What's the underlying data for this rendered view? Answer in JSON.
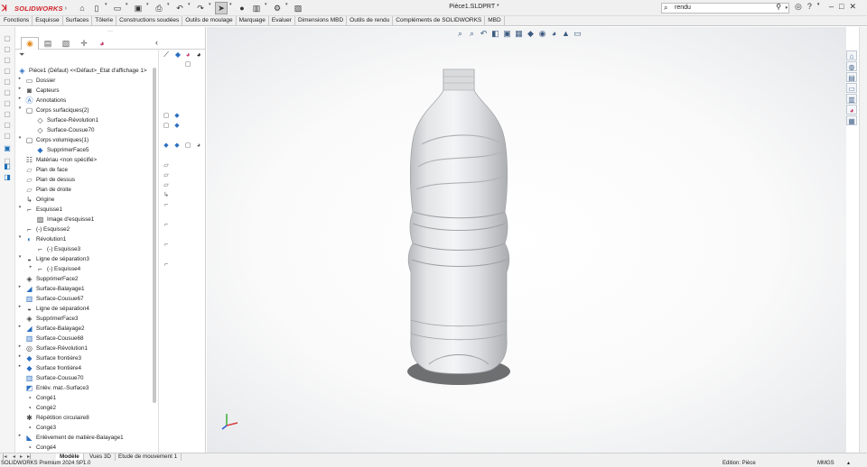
{
  "app": {
    "brand": "SOLIDWORKS",
    "document_title": "Pièce1.SLDPRT *"
  },
  "search": {
    "value": "rendu"
  },
  "command_tabs": [
    "Fonctions",
    "Esquisse",
    "Surfaces",
    "Tôlerie",
    "Constructions soudées",
    "Outils de moulage",
    "Marquage",
    "Evaluer",
    "Dimensions MBD",
    "Outils de rendu",
    "Compléments de SOLIDWORKS",
    "MBD"
  ],
  "feature_tree": {
    "root": "Pièce1 (Défaut) <<Défaut>_Etat d'affichage 1>",
    "items": [
      {
        "label": "Dossier",
        "icon": "folder-icon"
      },
      {
        "label": "Capteurs",
        "icon": "sensor-icon"
      },
      {
        "label": "Annotations",
        "icon": "annotation-icon"
      },
      {
        "label": "Corps surfaciques(2)",
        "icon": "surface-bodies-icon"
      },
      {
        "label": "Surface-Révolution1",
        "icon": "surface-icon"
      },
      {
        "label": "Surface-Cousue70",
        "icon": "surface-icon"
      },
      {
        "label": "Corps volumiques(1)",
        "icon": "solid-bodies-icon"
      },
      {
        "label": "SupprimerFace5",
        "icon": "solid-body-icon"
      },
      {
        "label": "Matériau <non spécifié>",
        "icon": "material-icon"
      },
      {
        "label": "Plan de face",
        "icon": "plane-icon"
      },
      {
        "label": "Plan de dessus",
        "icon": "plane-icon"
      },
      {
        "label": "Plan de droite",
        "icon": "plane-icon"
      },
      {
        "label": "Origine",
        "icon": "origin-icon"
      },
      {
        "label": "Esquisse1",
        "icon": "sketch-icon"
      },
      {
        "label": "Image d'esquisse1",
        "icon": "sketch-picture-icon"
      },
      {
        "label": "(-) Esquisse2",
        "icon": "sketch-icon"
      },
      {
        "label": "Révolution1",
        "icon": "revolve-icon"
      },
      {
        "label": "(-) Esquisse3",
        "icon": "sketch-icon"
      },
      {
        "label": "Ligne de séparation3",
        "icon": "split-line-icon"
      },
      {
        "label": "(-) Esquisse4",
        "icon": "sketch-icon"
      },
      {
        "label": "SupprimerFace2",
        "icon": "delete-face-icon"
      },
      {
        "label": "Surface-Balayage1",
        "icon": "sweep-surface-icon"
      },
      {
        "label": "Surface-Cousue67",
        "icon": "knit-surface-icon"
      },
      {
        "label": "Ligne de séparation4",
        "icon": "split-line-icon"
      },
      {
        "label": "SupprimerFace3",
        "icon": "delete-face-icon"
      },
      {
        "label": "Surface-Balayage2",
        "icon": "sweep-surface-icon"
      },
      {
        "label": "Surface-Cousue68",
        "icon": "knit-surface-icon"
      },
      {
        "label": "Surface-Révolution1",
        "icon": "revolve-surface-icon"
      },
      {
        "label": "Surface frontière3",
        "icon": "boundary-surface-icon"
      },
      {
        "label": "Surface frontière4",
        "icon": "boundary-surface-icon"
      },
      {
        "label": "Surface-Cousue70",
        "icon": "knit-surface-icon"
      },
      {
        "label": "Enlèv. mat.-Surface3",
        "icon": "cut-surface-icon"
      },
      {
        "label": "Congé1",
        "icon": "fillet-icon"
      },
      {
        "label": "Congé2",
        "icon": "fillet-icon"
      },
      {
        "label": "Répétition circulaire8",
        "icon": "circular-pattern-icon"
      },
      {
        "label": "Congé3",
        "icon": "fillet-icon"
      },
      {
        "label": "Enlèvement de matière-Balayage1",
        "icon": "swept-cut-icon"
      },
      {
        "label": "Congé4",
        "icon": "fillet-icon"
      }
    ]
  },
  "bottom_tabs": [
    "Modèle",
    "Vues 3D",
    "Etude de mouvement 1"
  ],
  "status": {
    "left": "SOLIDWORKS Premium 2024 SP1.0",
    "mode": "Edition: Pièce",
    "units": "MMGS"
  }
}
